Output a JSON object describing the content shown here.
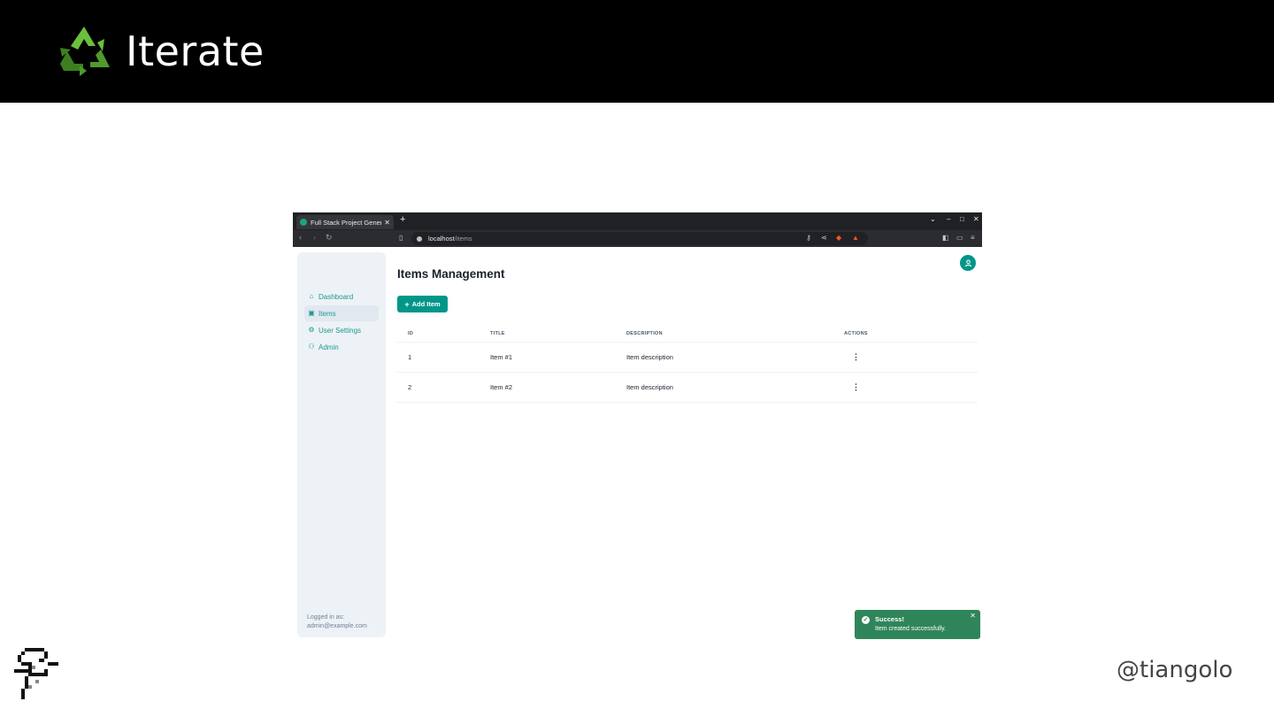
{
  "banner": {
    "title": "Iterate"
  },
  "browser": {
    "tab_title": "Full Stack Project Genera",
    "url_host": "localhost",
    "url_path": "/items"
  },
  "sidebar": {
    "items": [
      {
        "label": "Dashboard",
        "icon": "home-icon",
        "active": false
      },
      {
        "label": "Items",
        "icon": "briefcase-icon",
        "active": true
      },
      {
        "label": "User Settings",
        "icon": "settings-icon",
        "active": false
      },
      {
        "label": "Admin",
        "icon": "users-icon",
        "active": false
      }
    ],
    "logged_label": "Logged in as:",
    "logged_email": "admin@example.com"
  },
  "main": {
    "title": "Items Management",
    "add_button": "Add Item",
    "table": {
      "headers": [
        "ID",
        "TITLE",
        "DESCRIPTION",
        "ACTIONS"
      ],
      "rows": [
        {
          "id": "1",
          "title": "Item #1",
          "description": "Item description"
        },
        {
          "id": "2",
          "title": "Item #2",
          "description": "Item description"
        }
      ]
    }
  },
  "toast": {
    "title": "Success!",
    "message": "Item created successfully."
  },
  "footer": {
    "handle": "@tiangolo"
  },
  "colors": {
    "accent": "#009688",
    "toast": "#2f855a",
    "sidebar_bg": "#edf2f7"
  }
}
